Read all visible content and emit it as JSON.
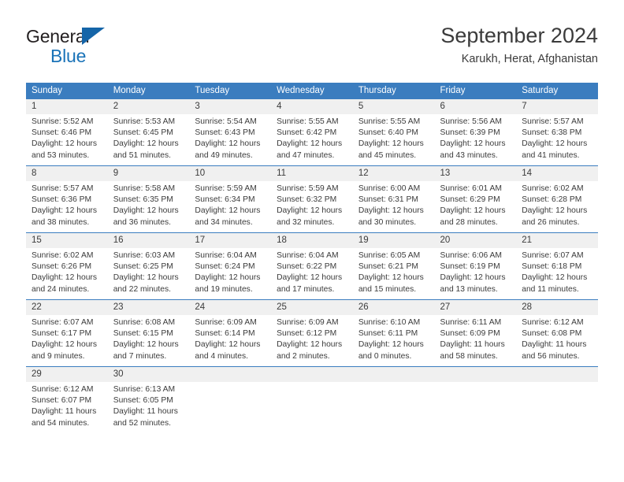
{
  "brand": {
    "name_top": "General",
    "name_bottom": "Blue",
    "triangle_icon": "triangle-icon",
    "color_dark": "#231f20",
    "color_blue": "#1a73b8"
  },
  "header": {
    "title": "September 2024",
    "location": "Karukh, Herat, Afghanistan"
  },
  "theme": {
    "header_bg": "#3b7dbf",
    "header_text": "#ffffff",
    "daynum_bg": "#f0f0f0",
    "cell_text": "#3b3b3b",
    "grid_line": "#3b7dbf"
  },
  "columns": [
    "Sunday",
    "Monday",
    "Tuesday",
    "Wednesday",
    "Thursday",
    "Friday",
    "Saturday"
  ],
  "weeks": [
    [
      {
        "day": "1",
        "sunrise": "Sunrise: 5:52 AM",
        "sunset": "Sunset: 6:46 PM",
        "daylight1": "Daylight: 12 hours",
        "daylight2": "and 53 minutes."
      },
      {
        "day": "2",
        "sunrise": "Sunrise: 5:53 AM",
        "sunset": "Sunset: 6:45 PM",
        "daylight1": "Daylight: 12 hours",
        "daylight2": "and 51 minutes."
      },
      {
        "day": "3",
        "sunrise": "Sunrise: 5:54 AM",
        "sunset": "Sunset: 6:43 PM",
        "daylight1": "Daylight: 12 hours",
        "daylight2": "and 49 minutes."
      },
      {
        "day": "4",
        "sunrise": "Sunrise: 5:55 AM",
        "sunset": "Sunset: 6:42 PM",
        "daylight1": "Daylight: 12 hours",
        "daylight2": "and 47 minutes."
      },
      {
        "day": "5",
        "sunrise": "Sunrise: 5:55 AM",
        "sunset": "Sunset: 6:40 PM",
        "daylight1": "Daylight: 12 hours",
        "daylight2": "and 45 minutes."
      },
      {
        "day": "6",
        "sunrise": "Sunrise: 5:56 AM",
        "sunset": "Sunset: 6:39 PM",
        "daylight1": "Daylight: 12 hours",
        "daylight2": "and 43 minutes."
      },
      {
        "day": "7",
        "sunrise": "Sunrise: 5:57 AM",
        "sunset": "Sunset: 6:38 PM",
        "daylight1": "Daylight: 12 hours",
        "daylight2": "and 41 minutes."
      }
    ],
    [
      {
        "day": "8",
        "sunrise": "Sunrise: 5:57 AM",
        "sunset": "Sunset: 6:36 PM",
        "daylight1": "Daylight: 12 hours",
        "daylight2": "and 38 minutes."
      },
      {
        "day": "9",
        "sunrise": "Sunrise: 5:58 AM",
        "sunset": "Sunset: 6:35 PM",
        "daylight1": "Daylight: 12 hours",
        "daylight2": "and 36 minutes."
      },
      {
        "day": "10",
        "sunrise": "Sunrise: 5:59 AM",
        "sunset": "Sunset: 6:34 PM",
        "daylight1": "Daylight: 12 hours",
        "daylight2": "and 34 minutes."
      },
      {
        "day": "11",
        "sunrise": "Sunrise: 5:59 AM",
        "sunset": "Sunset: 6:32 PM",
        "daylight1": "Daylight: 12 hours",
        "daylight2": "and 32 minutes."
      },
      {
        "day": "12",
        "sunrise": "Sunrise: 6:00 AM",
        "sunset": "Sunset: 6:31 PM",
        "daylight1": "Daylight: 12 hours",
        "daylight2": "and 30 minutes."
      },
      {
        "day": "13",
        "sunrise": "Sunrise: 6:01 AM",
        "sunset": "Sunset: 6:29 PM",
        "daylight1": "Daylight: 12 hours",
        "daylight2": "and 28 minutes."
      },
      {
        "day": "14",
        "sunrise": "Sunrise: 6:02 AM",
        "sunset": "Sunset: 6:28 PM",
        "daylight1": "Daylight: 12 hours",
        "daylight2": "and 26 minutes."
      }
    ],
    [
      {
        "day": "15",
        "sunrise": "Sunrise: 6:02 AM",
        "sunset": "Sunset: 6:26 PM",
        "daylight1": "Daylight: 12 hours",
        "daylight2": "and 24 minutes."
      },
      {
        "day": "16",
        "sunrise": "Sunrise: 6:03 AM",
        "sunset": "Sunset: 6:25 PM",
        "daylight1": "Daylight: 12 hours",
        "daylight2": "and 22 minutes."
      },
      {
        "day": "17",
        "sunrise": "Sunrise: 6:04 AM",
        "sunset": "Sunset: 6:24 PM",
        "daylight1": "Daylight: 12 hours",
        "daylight2": "and 19 minutes."
      },
      {
        "day": "18",
        "sunrise": "Sunrise: 6:04 AM",
        "sunset": "Sunset: 6:22 PM",
        "daylight1": "Daylight: 12 hours",
        "daylight2": "and 17 minutes."
      },
      {
        "day": "19",
        "sunrise": "Sunrise: 6:05 AM",
        "sunset": "Sunset: 6:21 PM",
        "daylight1": "Daylight: 12 hours",
        "daylight2": "and 15 minutes."
      },
      {
        "day": "20",
        "sunrise": "Sunrise: 6:06 AM",
        "sunset": "Sunset: 6:19 PM",
        "daylight1": "Daylight: 12 hours",
        "daylight2": "and 13 minutes."
      },
      {
        "day": "21",
        "sunrise": "Sunrise: 6:07 AM",
        "sunset": "Sunset: 6:18 PM",
        "daylight1": "Daylight: 12 hours",
        "daylight2": "and 11 minutes."
      }
    ],
    [
      {
        "day": "22",
        "sunrise": "Sunrise: 6:07 AM",
        "sunset": "Sunset: 6:17 PM",
        "daylight1": "Daylight: 12 hours",
        "daylight2": "and 9 minutes."
      },
      {
        "day": "23",
        "sunrise": "Sunrise: 6:08 AM",
        "sunset": "Sunset: 6:15 PM",
        "daylight1": "Daylight: 12 hours",
        "daylight2": "and 7 minutes."
      },
      {
        "day": "24",
        "sunrise": "Sunrise: 6:09 AM",
        "sunset": "Sunset: 6:14 PM",
        "daylight1": "Daylight: 12 hours",
        "daylight2": "and 4 minutes."
      },
      {
        "day": "25",
        "sunrise": "Sunrise: 6:09 AM",
        "sunset": "Sunset: 6:12 PM",
        "daylight1": "Daylight: 12 hours",
        "daylight2": "and 2 minutes."
      },
      {
        "day": "26",
        "sunrise": "Sunrise: 6:10 AM",
        "sunset": "Sunset: 6:11 PM",
        "daylight1": "Daylight: 12 hours",
        "daylight2": "and 0 minutes."
      },
      {
        "day": "27",
        "sunrise": "Sunrise: 6:11 AM",
        "sunset": "Sunset: 6:09 PM",
        "daylight1": "Daylight: 11 hours",
        "daylight2": "and 58 minutes."
      },
      {
        "day": "28",
        "sunrise": "Sunrise: 6:12 AM",
        "sunset": "Sunset: 6:08 PM",
        "daylight1": "Daylight: 11 hours",
        "daylight2": "and 56 minutes."
      }
    ],
    [
      {
        "day": "29",
        "sunrise": "Sunrise: 6:12 AM",
        "sunset": "Sunset: 6:07 PM",
        "daylight1": "Daylight: 11 hours",
        "daylight2": "and 54 minutes."
      },
      {
        "day": "30",
        "sunrise": "Sunrise: 6:13 AM",
        "sunset": "Sunset: 6:05 PM",
        "daylight1": "Daylight: 11 hours",
        "daylight2": "and 52 minutes."
      },
      {
        "day": "",
        "sunrise": "",
        "sunset": "",
        "daylight1": "",
        "daylight2": ""
      },
      {
        "day": "",
        "sunrise": "",
        "sunset": "",
        "daylight1": "",
        "daylight2": ""
      },
      {
        "day": "",
        "sunrise": "",
        "sunset": "",
        "daylight1": "",
        "daylight2": ""
      },
      {
        "day": "",
        "sunrise": "",
        "sunset": "",
        "daylight1": "",
        "daylight2": ""
      },
      {
        "day": "",
        "sunrise": "",
        "sunset": "",
        "daylight1": "",
        "daylight2": ""
      }
    ]
  ]
}
